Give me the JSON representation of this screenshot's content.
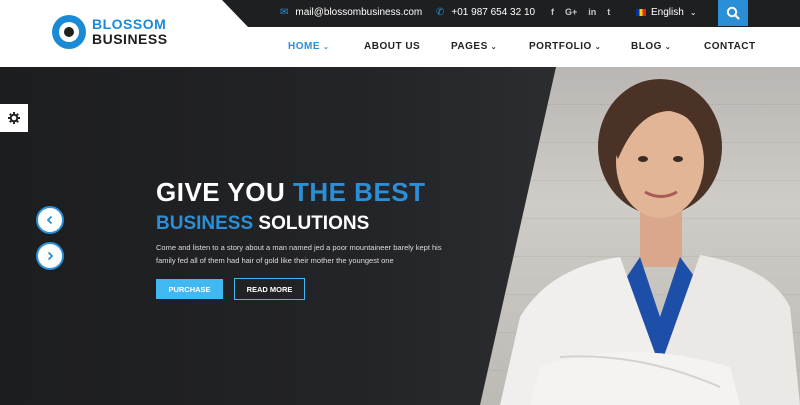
{
  "brand": {
    "line1": "BLOSSOM",
    "line2": "BUSINESS",
    "accent": "#2a8fd6"
  },
  "topbar": {
    "email": "mail@blossombusiness.com",
    "phone": "+01 987 654 32 10",
    "social": [
      "f",
      "G+",
      "in",
      "t"
    ],
    "language": "English"
  },
  "nav": {
    "home": "HOME",
    "about": "ABOUT US",
    "pages": "PAGES",
    "portfolio": "PORTFOLIO",
    "blog": "BLOG",
    "contact": "CONTACT"
  },
  "hero": {
    "title_white": "GIVE YOU ",
    "title_blue": "THE BEST",
    "subtitle_blue": "BUSINESS",
    "subtitle_white": " SOLUTIONS",
    "description": "Come and listen to a story about a man named jed a poor mountaineer barely kept his family fed all of them had hair of gold like their mother the youngest one",
    "purchase_label": "PURCHASE",
    "read_more_label": "READ MORE"
  },
  "icons": [
    "logo-mark",
    "email-icon",
    "phone-icon",
    "facebook-icon",
    "google-plus-icon",
    "linkedin-icon",
    "twitter-icon",
    "flag-icon",
    "search-icon",
    "gear-icon",
    "chevron-left-icon",
    "chevron-right-icon"
  ]
}
